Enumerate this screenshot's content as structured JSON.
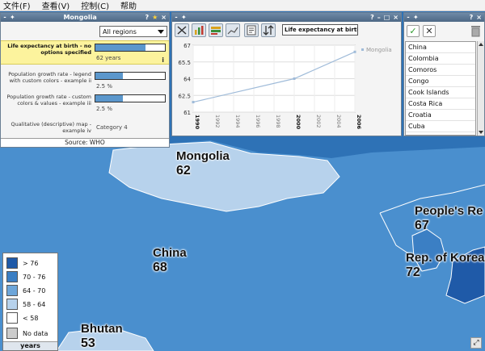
{
  "menu": [
    {
      "label": "文件(F)"
    },
    {
      "label": "查看(V)"
    },
    {
      "label": "控制(C)"
    },
    {
      "label": "帮助"
    }
  ],
  "indicator_panel": {
    "title": "Mongolia",
    "region_select": "All regions",
    "indicators": [
      {
        "label": "Life expectancy at birth - no options specified",
        "value": "62 years",
        "fill": 0.72,
        "active": true
      },
      {
        "label": "Population growth rate - legend with custom colors - example ii",
        "value": "2.5 %",
        "fill": 0.4,
        "active": false
      },
      {
        "label": "Population growth rate - custom colors & values - example iii",
        "value": "2.5 %",
        "fill": 0.4,
        "active": false
      }
    ],
    "qualitative": {
      "label": "Qualitative (descriptive) map - example iv",
      "value": "Category 4"
    },
    "source": "Source: WHO"
  },
  "chart_panel": {
    "indicator_select": "Life expectancy at birth"
  },
  "chart_data": {
    "type": "line",
    "series": [
      {
        "name": "Mongolia",
        "x": [
          1990,
          2000,
          2006
        ],
        "values": [
          61.9,
          64,
          66.4
        ]
      }
    ],
    "x_ticks": [
      "1990",
      "1992",
      "1994",
      "1996",
      "1998",
      "2000",
      "2002",
      "2004",
      "2006"
    ],
    "x_ticks_bold": [
      "1990",
      "2000",
      "2006"
    ],
    "y_ticks": [
      "61",
      "62.5",
      "64",
      "65.5",
      "67"
    ],
    "xlim": [
      1990,
      2006
    ],
    "ylim": [
      61,
      67
    ],
    "grid": true,
    "legend_position": "right",
    "line_color": "#9fbbd9"
  },
  "country_list": {
    "items": [
      "China",
      "Colombia",
      "Comoros",
      "Congo",
      "Cook Islands",
      "Costa Rica",
      "Croatia",
      "Cuba"
    ]
  },
  "map_labels": [
    {
      "name": "Mongolia",
      "value": "62"
    },
    {
      "name": "China",
      "value": "68"
    },
    {
      "name": "People's Re",
      "value": "67"
    },
    {
      "name": "Rep. of Korea",
      "value": "72"
    },
    {
      "name": "Bhutan",
      "value": "53"
    }
  ],
  "legend": {
    "items": [
      {
        "label": "> 76",
        "color": "#1f5aa8"
      },
      {
        "label": "70 - 76",
        "color": "#3b7fc4"
      },
      {
        "label": "64 - 70",
        "color": "#6ea6d9"
      },
      {
        "label": "58 - 64",
        "color": "#b7d2ec"
      },
      {
        "label": "< 58",
        "color": "#ffffff"
      },
      {
        "label": "No data",
        "color": "#cccccc"
      }
    ],
    "unit": "years"
  }
}
